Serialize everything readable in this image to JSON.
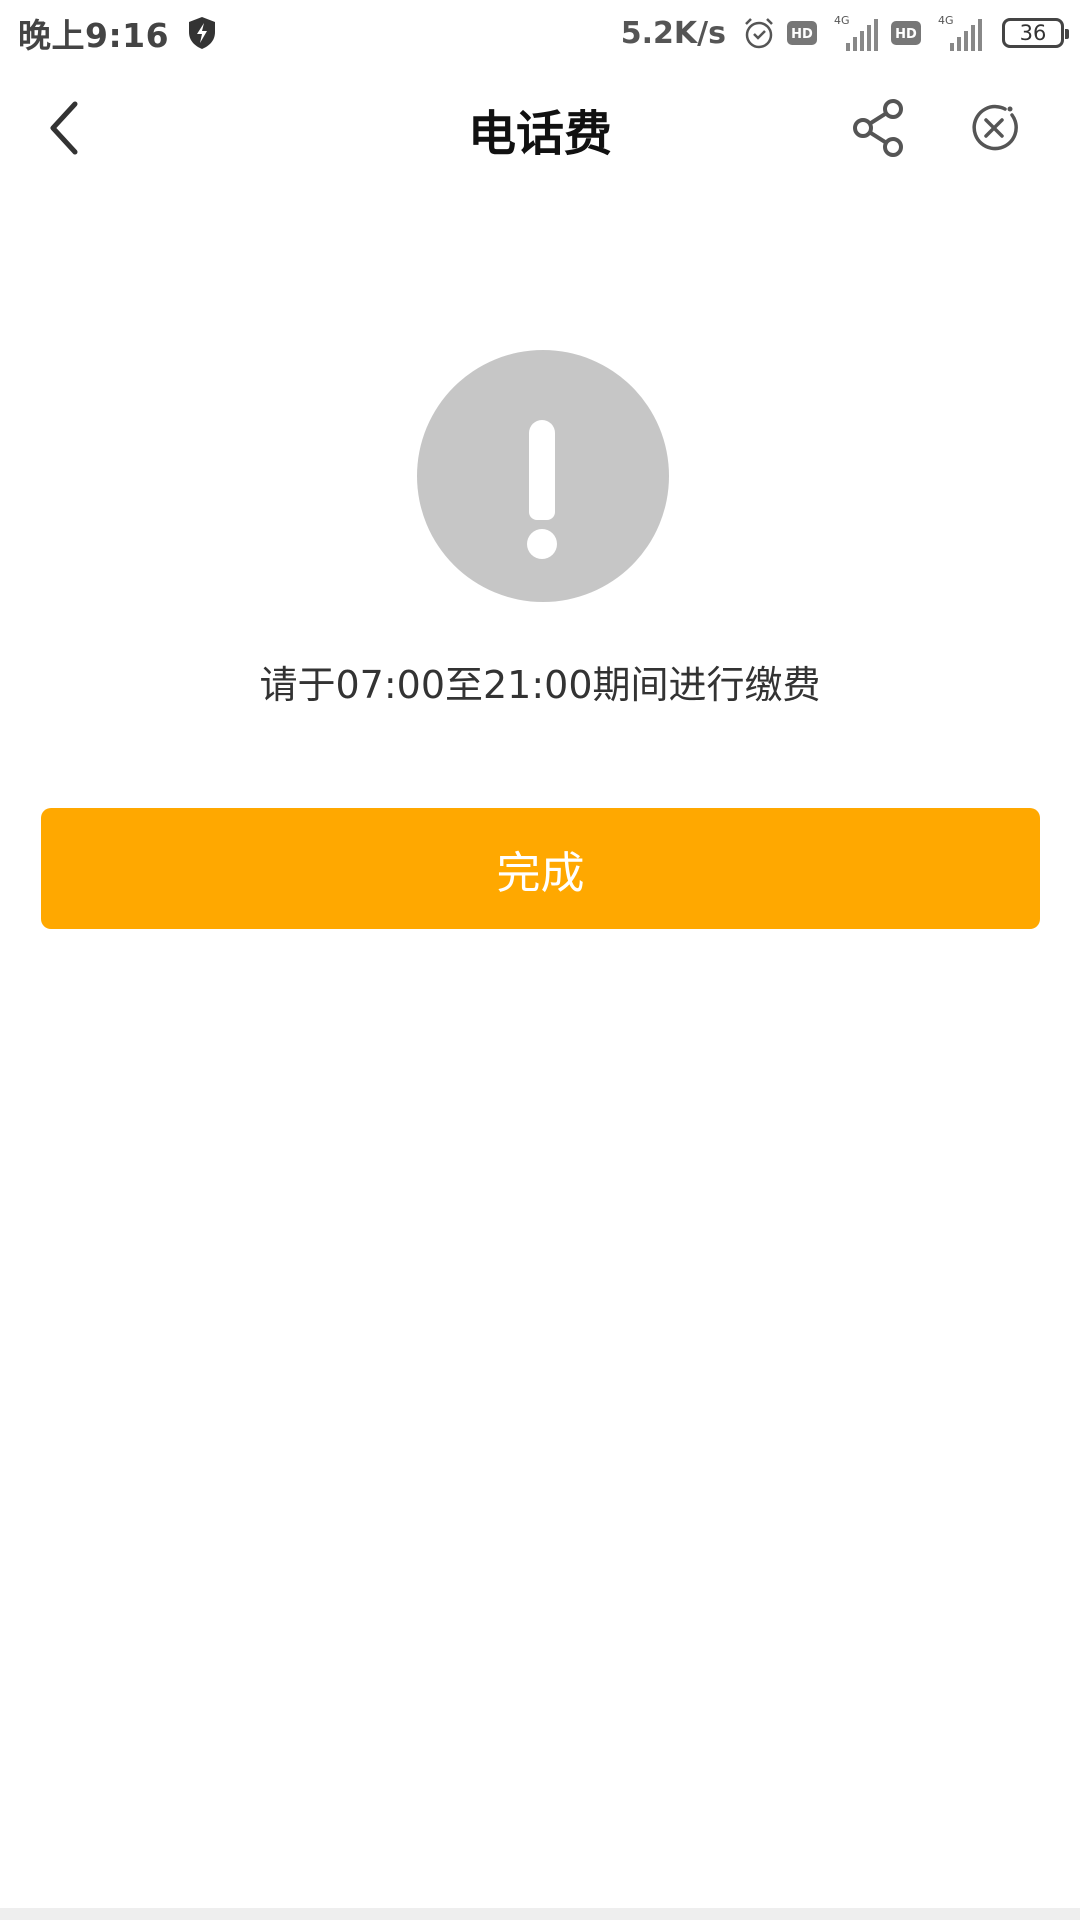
{
  "status_bar": {
    "time": "晚上9:16",
    "network_speed": "5.2K/s",
    "network_type_1": "4G",
    "network_type_2": "4G",
    "hd_label": "HD",
    "battery_level": "36",
    "icons": [
      "shield-bolt-icon",
      "alarm-icon",
      "hd-icon",
      "signal-icon",
      "hd-icon",
      "signal-icon",
      "battery-icon"
    ]
  },
  "nav": {
    "title": "电话费",
    "back_icon": "chevron-left-icon",
    "share_icon": "share-icon",
    "close_icon": "close-circle-icon"
  },
  "content": {
    "alert_icon": "exclamation-circle-icon",
    "message": "请于07:00至21:00期间进行缴费"
  },
  "actions": {
    "done_label": "完成"
  },
  "colors": {
    "accent": "#ffa800",
    "alert_circle": "#c6c6c6",
    "background": "#ffffff"
  }
}
